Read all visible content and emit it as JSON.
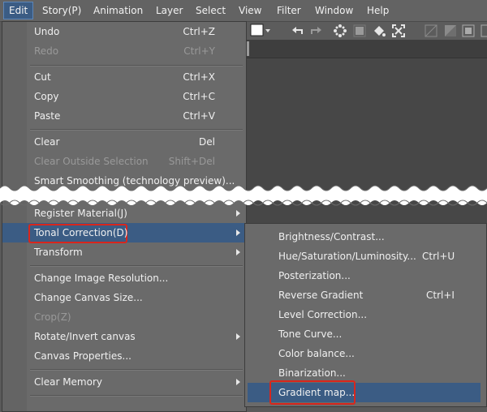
{
  "menubar": {
    "items": [
      "Edit",
      "Story(P)",
      "Animation",
      "Layer",
      "Select",
      "View",
      "Filter",
      "Window",
      "Help"
    ]
  },
  "edit_menu": {
    "undo": {
      "label": "Undo",
      "shortcut": "Ctrl+Z"
    },
    "redo": {
      "label": "Redo",
      "shortcut": "Ctrl+Y"
    },
    "cut": {
      "label": "Cut",
      "shortcut": "Ctrl+X"
    },
    "copy": {
      "label": "Copy",
      "shortcut": "Ctrl+C"
    },
    "paste": {
      "label": "Paste",
      "shortcut": "Ctrl+V"
    },
    "clear": {
      "label": "Clear",
      "shortcut": "Del"
    },
    "clear_outside": {
      "label": "Clear Outside Selection",
      "shortcut": "Shift+Del"
    },
    "smart_smoothing": {
      "label": "Smart Smoothing (technology preview)..."
    },
    "register_material": {
      "label": "Register Material(J)"
    },
    "tonal_correction": {
      "label": "Tonal Correction(D)"
    },
    "transform": {
      "label": "Transform"
    },
    "change_image_resolution": {
      "label": "Change Image Resolution..."
    },
    "change_canvas_size": {
      "label": "Change Canvas Size..."
    },
    "crop": {
      "label": "Crop(Z)"
    },
    "rotate_invert": {
      "label": "Rotate/Invert canvas"
    },
    "canvas_properties": {
      "label": "Canvas Properties..."
    },
    "clear_memory": {
      "label": "Clear Memory"
    }
  },
  "submenu": {
    "brightness": {
      "label": "Brightness/Contrast..."
    },
    "hue": {
      "label": "Hue/Saturation/Luminosity...",
      "shortcut": "Ctrl+U"
    },
    "posterization": {
      "label": "Posterization..."
    },
    "reverse_gradient": {
      "label": "Reverse Gradient",
      "shortcut": "Ctrl+I"
    },
    "level_correction": {
      "label": "Level Correction..."
    },
    "tone_curve": {
      "label": "Tone Curve..."
    },
    "color_balance": {
      "label": "Color balance..."
    },
    "binarization": {
      "label": "Binarization..."
    },
    "gradient_map": {
      "label": "Gradient map..."
    }
  },
  "colors": {
    "highlight": "#3b5c84",
    "callout": "#d9261c"
  }
}
